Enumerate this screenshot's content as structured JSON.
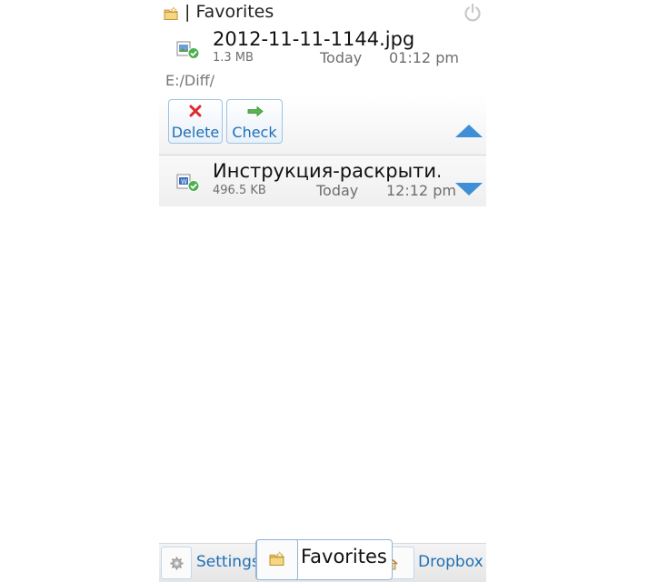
{
  "header": {
    "title": "| Favorites",
    "folder_icon": "folder-star-icon",
    "power_icon": "power-icon"
  },
  "files": [
    {
      "name": "2012-11-11-1144.jpg",
      "size": "1.3 MB",
      "date": "Today",
      "time": "01:12 pm",
      "path": "E:/Diff/",
      "icon": "synced-file-icon"
    },
    {
      "name": "Инструкция-раскрыти...",
      "size": "496.5 KB",
      "date": "Today",
      "time": "12:12 pm",
      "icon": "synced-file-icon"
    }
  ],
  "actions": {
    "delete_label": "Delete",
    "check_label": "Check"
  },
  "tabs": [
    {
      "label": "Settings",
      "icon": "gear-icon"
    },
    {
      "label": "Favorites",
      "icon": "folder-star-icon",
      "active": true
    },
    {
      "label": "Dropbox",
      "icon": "home-icon"
    }
  ],
  "colors": {
    "accent": "#1f6fb5",
    "arrow": "#3f8fd6",
    "delete": "#e0292b",
    "check": "#3a9a3a",
    "synced": "#4cb050"
  }
}
